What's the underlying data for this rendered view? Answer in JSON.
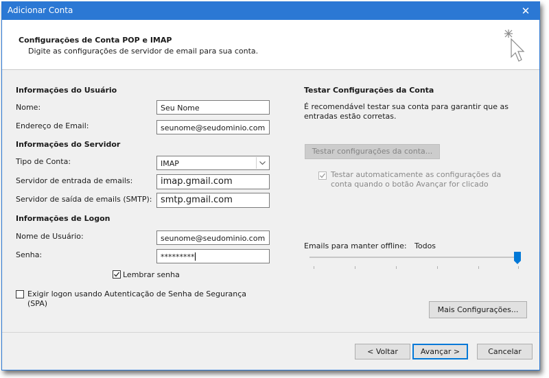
{
  "window": {
    "title": "Adicionar Conta",
    "close_glyph": "✕"
  },
  "header": {
    "title": "Configurações de Conta POP e IMAP",
    "subtitle": "Digite as configurações de servidor de email para sua conta."
  },
  "user_info": {
    "section": "Informações do Usuário",
    "name_label": "Nome:",
    "name_value": "Seu Nome",
    "email_label": "Endereço de Email:",
    "email_value": "seunome@seudominio.com"
  },
  "server_info": {
    "section": "Informações do Servidor",
    "account_type_label": "Tipo de Conta:",
    "account_type_value": "IMAP",
    "incoming_label": "Servidor de entrada de emails:",
    "incoming_value": "imap.gmail.com",
    "outgoing_label": "Servidor de saída de emails (SMTP):",
    "outgoing_value": "smtp.gmail.com"
  },
  "logon_info": {
    "section": "Informações de Logon",
    "username_label": "Nome de Usuário:",
    "username_value": "seunome@seudominio.com",
    "password_label": "Senha:",
    "password_value": "*********",
    "remember_label": "Lembrar senha",
    "remember_checked": true,
    "spa_label_line1": "Exigir logon usando Autenticação de Senha de Segurança",
    "spa_label_line2": "(SPA)",
    "spa_checked": false
  },
  "test_settings": {
    "section": "Testar Configurações da Conta",
    "desc_line1": "É recomendável testar sua conta para garantir que as",
    "desc_line2": "entradas estão corretas.",
    "test_button": "Testar configurações da conta...",
    "auto_test_line1": "Testar automaticamente as configurações da",
    "auto_test_line2": "conta quando o botão Avançar for clicado",
    "auto_test_checked": true
  },
  "offline": {
    "label": "Emails para manter offline:",
    "value": "Todos",
    "slider_fraction": 1.0
  },
  "buttons": {
    "more_settings": "Mais Configurações...",
    "back": "< Voltar",
    "next": "Avançar >",
    "cancel": "Cancelar"
  },
  "colors": {
    "titlebar": "#2b78d4",
    "slider_thumb": "#0078d7"
  }
}
